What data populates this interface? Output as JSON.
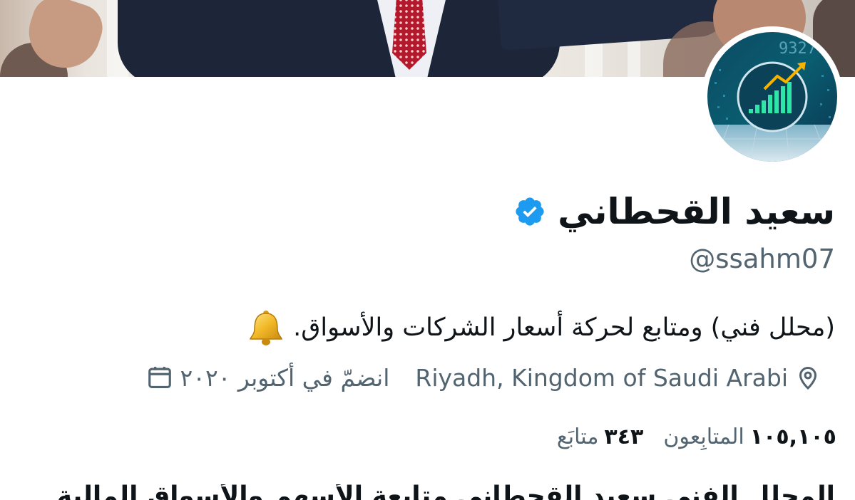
{
  "profile": {
    "display_name": "سعيد القحطاني",
    "handle": "@ssahm07",
    "verified": true,
    "bio": "(محلل فني) ومتابع لحركة أسعار الشركات والأسواق.",
    "location": "Riyadh, Kingdom of Saudi Arabi",
    "joined": "انضمّ في أكتوبر ٢٠٢٠",
    "following_count": "٣٤٣",
    "following_label": "متابَع",
    "followers_count": "١٠٥,١٠٥",
    "followers_label": "المتابِعون",
    "partial_text": "المحلل الفني سعيد القحطاني متابعة الأسهم والأسواق المالية"
  },
  "icons": {
    "verified": "verified-badge-icon",
    "bell": "bell-icon",
    "location": "location-pin-icon",
    "calendar": "calendar-icon"
  },
  "colors": {
    "verified_blue": "#1d9bf0",
    "secondary_text": "#536471",
    "primary_text": "#0f1419"
  }
}
